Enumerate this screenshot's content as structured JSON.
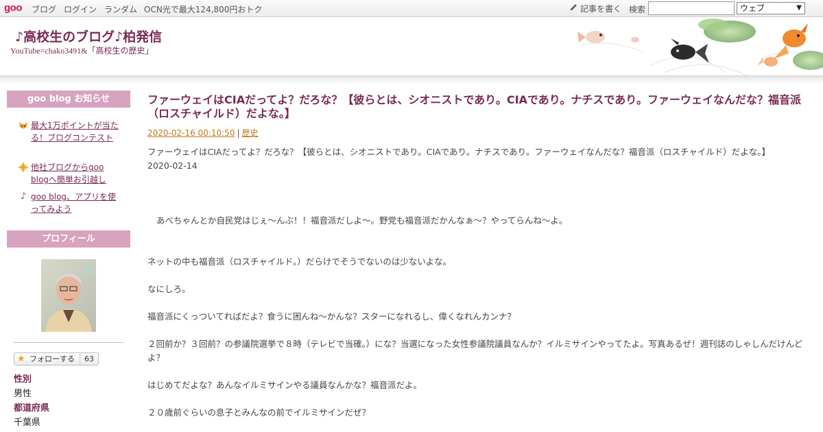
{
  "topbar": {
    "logo": "goo",
    "nav": [
      "ブログ",
      "ログイン",
      "ランダム",
      "OCN光で最大124,800円おトク"
    ],
    "write_label": "記事を書く",
    "search_label": "検索",
    "search_value": "",
    "search_scope": "ウェブ"
  },
  "header": {
    "title": "♪高校生のブログ♪柏発信",
    "description": "YouTube=chako3491&「高校生の歴史」"
  },
  "sidebar": {
    "notice_heading": "goo blog お知らせ",
    "notices": [
      {
        "icon": "fox-icon",
        "label": "最大1万ポイントが当たる！ブログコンテスト"
      },
      {
        "icon": "sparkle-icon",
        "label": "他社ブログからgoo blogへ簡単お引越し"
      },
      {
        "icon": "music-note-icon",
        "label": "goo blog、アプリを使ってみよう"
      }
    ],
    "profile_heading": "プロフィール",
    "follow_label": "フォローする",
    "follow_count": "63",
    "profile": [
      {
        "label": "性別",
        "value": "男性"
      },
      {
        "label": "都道府県",
        "value": "千葉県"
      }
    ]
  },
  "entry": {
    "title": "ファーウェイはCIAだってよ？だろな？【彼らとは、シオニストであり。CIAであり。ナチスであり。ファーウェイなんだな？福音派（ロスチャイルド）だよな。】",
    "date": "2020-02-16 00:10:50",
    "category": "歴史",
    "lines": [
      "ファーウェイはCIAだってよ？だろな？【彼らとは、シオニストであり。CIAであり。ナチスであり。ファーウェイなんだな？福音派（ロスチャイルド）だよな。】",
      "2020-02-14",
      "あべちゃんとか自民党はじぇ〜んぶ！！福音派だしよ〜。野党も福音派だかんなぁ〜？やってらんね〜よ。",
      "ネットの中も福音派（ロスチャイルド。）だらけでそうでないのは少ないよな。",
      "なにしろ。",
      "福音派にくっついてればだよ？食うに困んね〜かんな？スターになれるし、偉くなれんカンナ？",
      "２回前か？３回前？の参議院選挙で８時（テレビで当確。）にな？当選になった女性参議院議員なんか？イルミサインやってたよ。写真あるぜ！週刊誌のしゃしんだけんどよ？",
      "はじめてだよな？あんなイルミサインやる議員なんかな？福音派だよ。",
      "２０歳前ぐらいの息子とみんなの前でイルミサインだぜ？"
    ]
  }
}
